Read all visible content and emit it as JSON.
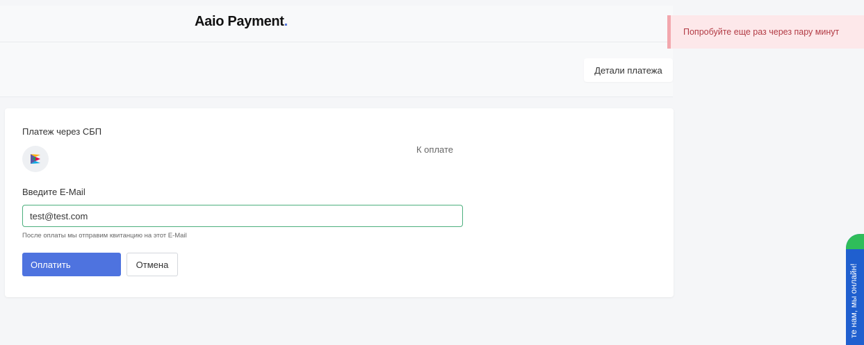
{
  "header": {
    "logo_text": "Aaio Payment",
    "logo_dot": "."
  },
  "details_button": {
    "label": "Детали платежа"
  },
  "toast": {
    "message": "Попробуйте еще раз через пару минут"
  },
  "payment": {
    "method_title": "Платеж через СБП",
    "method_icon": "sbp-logo",
    "amount_label": "К оплате"
  },
  "email": {
    "label": "Введите E-Mail",
    "value": "test@test.com",
    "hint": "После оплаты мы отправим квитанцию на этот E-Mail"
  },
  "actions": {
    "pay_label": "Оплатить",
    "cancel_label": "Отмена"
  },
  "chat": {
    "label": "те нам, мы онлайн!"
  },
  "colors": {
    "accent": "#4e73df",
    "input_border": "#4caf7d",
    "toast_bg": "#fde8ea",
    "toast_text": "#b23a44",
    "chat_bg": "#1f5fcf",
    "chat_top": "#2fbd5a"
  }
}
